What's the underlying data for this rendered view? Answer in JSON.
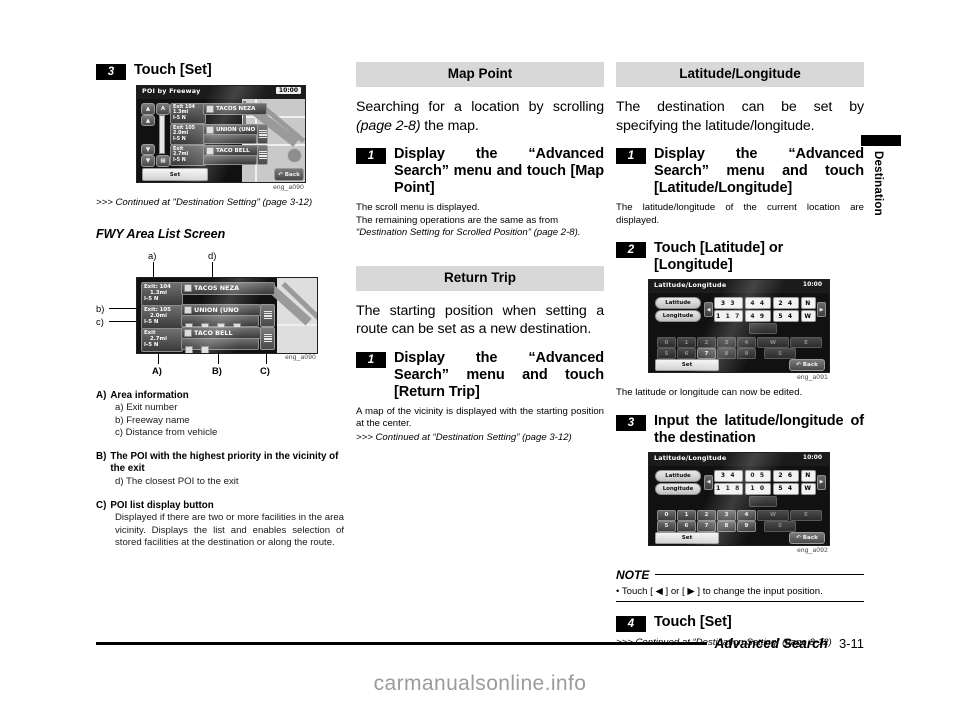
{
  "footer": {
    "section": "Advanced Search",
    "page": "3-11",
    "side_tab": "Destination"
  },
  "watermark": "carmanualsonline.info",
  "left_column": {
    "step3": {
      "num": "3",
      "title": "Touch [Set]"
    },
    "poi_screen": {
      "title": "POI by Freeway",
      "clock": "10:00",
      "set_label": "Set",
      "back_label": "Back",
      "rows": [
        {
          "exit": "Exit  104",
          "dist": "1.3mi",
          "road": "I-5 N",
          "name": "TACOS NEZA",
          "has_list": false
        },
        {
          "exit": "Exit  105",
          "dist": "2.0mi",
          "road": "I-5 N",
          "name": "UNION (UNO",
          "has_list": true
        },
        {
          "exit": "Exit",
          "dist": "2.7mi",
          "road": "I-5 N",
          "name": "TACO BELL",
          "has_list": true
        }
      ],
      "caption": "eng_a090"
    },
    "continued_1": ">>> Continued at \"Destination Setting\" (page 3-12)",
    "subhead": "FWY Area List Screen",
    "fwy_screen": {
      "caption": "eng_a090",
      "callouts": {
        "a": "a)",
        "b": "b)",
        "c": "c)",
        "d": "d)",
        "A": "A)",
        "B": "B)",
        "C": "C)"
      },
      "rows": [
        {
          "exit": "Exit: 104",
          "dist": "1.3mi",
          "road": "I-5 N",
          "name": "TACOS NEZA",
          "has_list": false
        },
        {
          "exit": "Exit: 105",
          "dist": "2.0mi",
          "road": "I-5 N",
          "name": "UNION (UNO",
          "has_list": true
        },
        {
          "exit": "Exit",
          "dist": "2.7mi",
          "road": "I-5 N",
          "name": "TACO BELL",
          "has_list": true
        }
      ]
    },
    "legend": [
      {
        "label": "A)",
        "heading": "Area information",
        "items": [
          "a) Exit number",
          "b) Freeway name",
          "c) Distance from vehicle"
        ],
        "paragraph": ""
      },
      {
        "label": "B)",
        "heading": "The POI with the highest priority in the vicinity of the exit",
        "items": [
          "d) The closest POI to the exit"
        ],
        "paragraph": ""
      },
      {
        "label": "C)",
        "heading": "POI list display button",
        "items": [],
        "paragraph": "Displayed if there are two or more facilities in the area vicinity. Displays the list and enables selection of stored facilities at the destination or along the route."
      }
    ]
  },
  "mid_column": {
    "map_point": {
      "band": "Map Point",
      "intro_1": "Searching for a location by scrolling ",
      "intro_italic": "(page 2-8)",
      "intro_2": " the map.",
      "step1": {
        "num": "1",
        "title": "Display the “Advanced Search” menu and touch [Map Point]"
      },
      "sub_1": "The scroll menu is displayed.",
      "sub_2": "The remaining operations are the same as from",
      "sub_3": "“Destination Setting for Scrolled Position” (page 2-8)."
    },
    "return_trip": {
      "band": "Return Trip",
      "intro": "The starting position when setting a route can be set as a new destination.",
      "step1": {
        "num": "1",
        "title": "Display the “Advanced Search” menu and touch [Return Trip]"
      },
      "sub_1": "A map of the vicinity is displayed with the starting position at the center.",
      "continued": ">>> Continued at “Destination Setting” (page 3-12)"
    }
  },
  "right_column": {
    "band": "Latitude/Longitude",
    "intro": "The destination can be set by specifying the latitude/longitude.",
    "step1": {
      "num": "1",
      "title": "Display the “Advanced Search” menu and touch [Latitude/Longitude]"
    },
    "step1_sub": "The latitude/longitude of the current location are displayed.",
    "step2": {
      "num": "2",
      "title": "Touch [Latitude] or [Longitude]"
    },
    "shot_a091": {
      "title": "Latitude/Longitude",
      "clock": "10:00",
      "lat_label": "Latitude",
      "lon_label": "Longitude",
      "lat_values": [
        "3 3",
        "4 4",
        "2 4",
        "N"
      ],
      "lon_values": [
        "1 1 7",
        "4 9",
        "5 4",
        "W"
      ],
      "keys_row1": [
        "0",
        "1",
        "2",
        "3",
        "4",
        "W",
        "E"
      ],
      "keys_row2": [
        "5",
        "6",
        "7",
        "8",
        "9",
        "S"
      ],
      "set_label": "Set",
      "back_label": "Back",
      "caption": "eng_a091"
    },
    "after_a091": "The latitude or longitude can now be edited.",
    "step3": {
      "num": "3",
      "title": "Input the latitude/longitude of the destination"
    },
    "shot_a092": {
      "title": "Latitude/Longitude",
      "clock": "10:00",
      "lat_label": "Latitude",
      "lon_label": "Longitude",
      "lat_values": [
        "3 4",
        "0 5",
        "2 6",
        "N"
      ],
      "lon_values": [
        "1 1 8",
        "1 0",
        "5 4",
        "W"
      ],
      "keys_row1": [
        "0",
        "1",
        "2",
        "3",
        "4",
        "W",
        "E"
      ],
      "keys_row2": [
        "5",
        "6",
        "7",
        "8",
        "9",
        "S"
      ],
      "set_label": "Set",
      "back_label": "Back",
      "caption": "eng_a092"
    },
    "note": {
      "word": "NOTE",
      "bullet": "• Touch [ ◀ ] or [ ▶ ] to change the input position."
    },
    "step4": {
      "num": "4",
      "title": "Touch [Set]"
    },
    "continued": ">>> Continued at “Destination Setting” (page 3-12)"
  }
}
